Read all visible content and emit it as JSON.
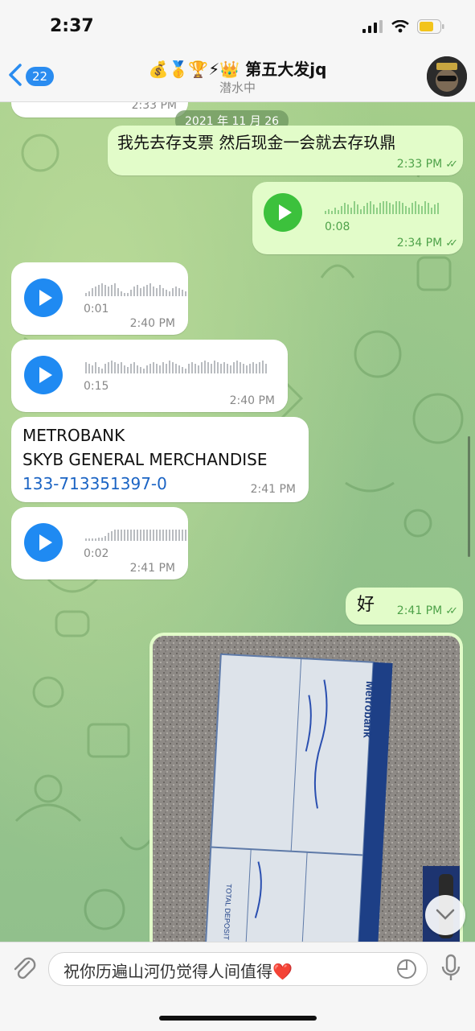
{
  "status": {
    "time": "2:37"
  },
  "header": {
    "back_count": "22",
    "title_emoji": "💰🥇🏆⚡👑",
    "title": "第五大发jq",
    "subtitle": "潜水中"
  },
  "date_pill": "2021 年 11 月 26",
  "messages": [
    {
      "type": "incoming",
      "time": "2:33 PM"
    },
    {
      "type": "outgoing-text",
      "text": "我先去存支票 然后现金一会就去存玖鼎",
      "time": "2:33 PM"
    },
    {
      "type": "outgoing-voice",
      "duration": "0:08",
      "time": "2:34 PM"
    },
    {
      "type": "incoming-voice",
      "duration": "0:01",
      "time": "2:40 PM"
    },
    {
      "type": "incoming-voice",
      "duration": "0:15",
      "time": "2:40 PM"
    },
    {
      "type": "incoming-text",
      "lines": [
        "METROBANK",
        "SKYB GENERAL MERCHANDISE"
      ],
      "link": "133-713351397-0",
      "time": "2:41 PM"
    },
    {
      "type": "incoming-voice",
      "duration": "0:02",
      "time": "2:41 PM"
    },
    {
      "type": "outgoing-text",
      "text": "好",
      "time": "2:41 PM"
    },
    {
      "type": "outgoing-photo",
      "caption_brand": "Metrobank",
      "slip_label": "TOTAL DEPOSIT"
    }
  ],
  "input": {
    "value": "祝你历遍山河仍觉得人间值得❤️"
  },
  "icons": [
    "back-chevron-icon",
    "signal-icon",
    "wifi-icon",
    "battery-icon",
    "play-icon",
    "attach-icon",
    "sticker-icon",
    "microphone-icon",
    "chevron-down-icon"
  ],
  "colors": {
    "accent": "#2a8cf0",
    "outgoing_bubble": "#e2fcc9",
    "voice_green": "#3cc13c",
    "voice_blue": "#1f8af2"
  }
}
